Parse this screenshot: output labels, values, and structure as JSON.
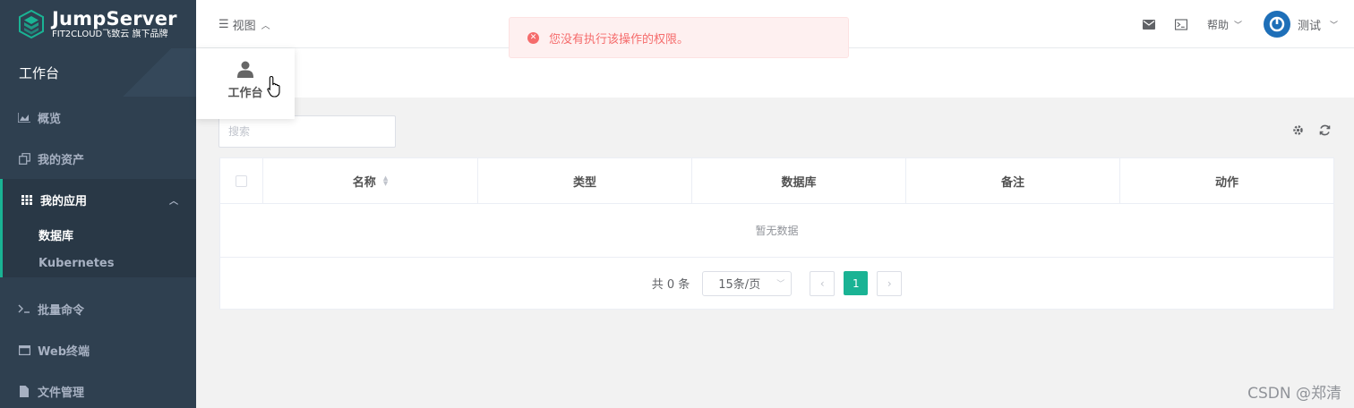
{
  "brand": {
    "title": "JumpServer",
    "subtitle": "FIT2CLOUD飞致云 旗下品牌",
    "accent": "#1ab394"
  },
  "sidebar": {
    "workbench": "工作台",
    "items": [
      {
        "label": "概览",
        "icon": "chart-area-icon"
      },
      {
        "label": "我的资产",
        "icon": "copy-icon"
      },
      {
        "label": "我的应用",
        "icon": "grid-icon",
        "expanded": true,
        "children": [
          {
            "label": "数据库",
            "active": true
          },
          {
            "label": "Kubernetes"
          }
        ]
      },
      {
        "label": "批量命令",
        "icon": "terminal-icon"
      },
      {
        "label": "Web终端",
        "icon": "window-icon"
      },
      {
        "label": "文件管理",
        "icon": "file-icon"
      }
    ]
  },
  "topbar": {
    "view_label": "视图",
    "help_label": "帮助",
    "user_name": "测试"
  },
  "dropdown": {
    "item_label": "工作台"
  },
  "toast": {
    "message": "您没有执行该操作的权限。",
    "color": "#f56c6c"
  },
  "search": {
    "placeholder": "搜索"
  },
  "table": {
    "columns": [
      "名称",
      "类型",
      "数据库",
      "备注",
      "动作"
    ],
    "empty_text": "暂无数据"
  },
  "pagination": {
    "total_text": "共 0 条",
    "page_size": "15条/页",
    "current_page": "1"
  },
  "watermark": "CSDN @郑清"
}
